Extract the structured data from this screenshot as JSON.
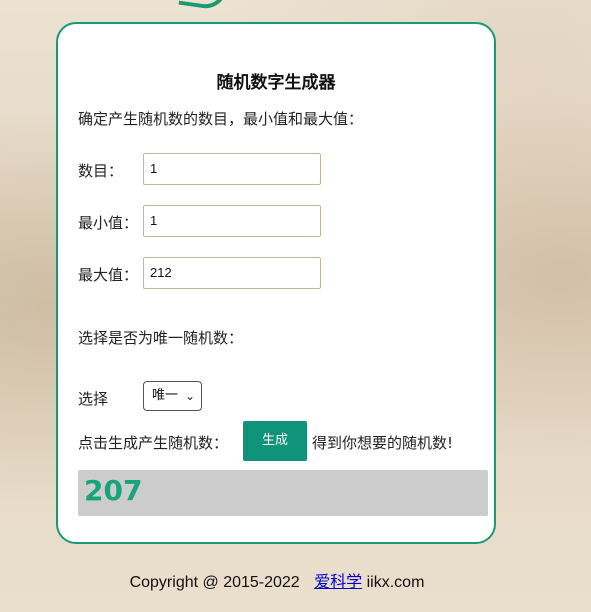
{
  "card": {
    "title": "随机数字生成器",
    "instruction": "确定产生随机数的数目，最小值和最大值：",
    "fields": [
      {
        "label": "数目：",
        "value": "1"
      },
      {
        "label": "最小值：",
        "value": "1"
      },
      {
        "label": "最大值：",
        "value": "212"
      }
    ],
    "unique_prompt": "选择是否为唯一随机数：",
    "select_label": "选择",
    "select_value": "唯一",
    "generate_prompt": "点击生成产生随机数：",
    "generate_button": "生成",
    "generate_after": "得到你想要的随机数!",
    "result": "207"
  },
  "footer": {
    "copyright": "Copyright @ 2015-2022",
    "link_text": "爱科学",
    "domain": "iikx.com"
  },
  "colors": {
    "accent": "#1a9a72",
    "button": "#0f9479",
    "result_text": "#17a37c",
    "result_bg": "#cccccc"
  }
}
